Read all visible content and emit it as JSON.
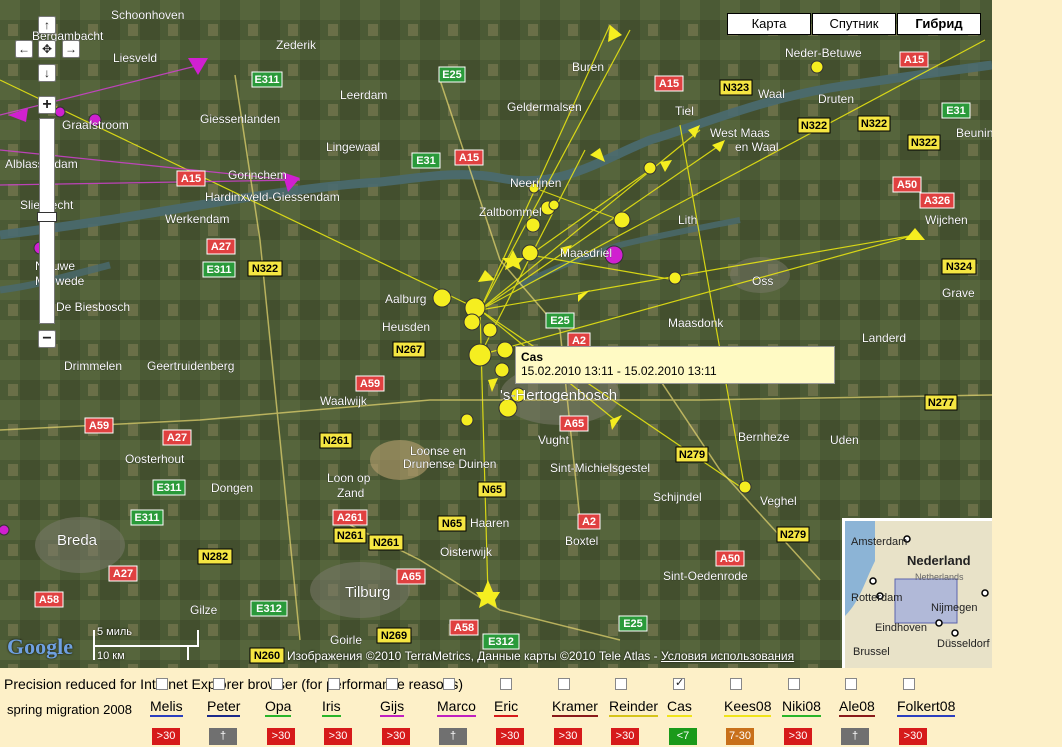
{
  "map": {
    "map_types": [
      "Карта",
      "Спутник",
      "Гибрид"
    ],
    "active_map_type": "Гибрид",
    "popup": {
      "title": "Cas",
      "time": "15.02.2010 13:11 - 15.02.2010 13:11"
    },
    "copyright": "Изображения ©2010 TerraMetrics, Данные карты ©2010 Tele Atlas - ",
    "terms_link": "Условия использования",
    "scale_miles": "5 миль",
    "scale_km": "10 км",
    "logo": "Google",
    "places": [
      "Schoonhoven",
      "Bergambacht",
      "Liesveld",
      "Zederik",
      "Buren",
      "Neder-Betuwe",
      "Leerdam",
      "Geldermalsen",
      "Tiel",
      "Waal",
      "Druten",
      "Giessenlanden",
      "Graafstroom",
      "Lingewaal",
      "West Maas en Waal",
      "Beunin",
      "Alblasserdam",
      "Gorinchem",
      "Neerijnen",
      "Hardinxveld-Giessendam",
      "Sliedrecht",
      "Zaltbommel",
      "Werkendam",
      "Lith",
      "Wijchen",
      "Maasdriel",
      "Oss",
      "Grave",
      "Nieuwe Merwede",
      "Aalburg",
      "De Biesbosch",
      "Heusden",
      "Maasdonk",
      "Landerd",
      "Drimmelen",
      "Geertruidenberg",
      "Waalwijk",
      "'s-Hertogenbosch",
      "Vught",
      "Bernheze",
      "Uden",
      "Loonse en Drunense Duinen",
      "Oosterhout",
      "Loon op Zand",
      "Sint-Michielsgestel",
      "Schijndel",
      "Veghel",
      "Dongen",
      "Haaren",
      "Boxtel",
      "Breda",
      "Oisterwijk",
      "Tilburg",
      "Sint-Oedenrode",
      "Gilze",
      "Goirle"
    ],
    "roads": [
      "E25",
      "E311",
      "A15",
      "N323",
      "E31",
      "N322",
      "A50",
      "A326",
      "A27",
      "N324",
      "A2",
      "N267",
      "A59",
      "A65",
      "N277",
      "N261",
      "A261",
      "N65",
      "N279",
      "E312",
      "N282",
      "N269",
      "A58",
      "N260"
    ],
    "overview_labels": [
      "Amsterdam",
      "Nederland",
      "Netherlands",
      "Rotterdam",
      "Nijmegen",
      "Eindhoven",
      "Düsseldorf",
      "Brussel"
    ]
  },
  "footer": {
    "precision_note": "Precision reduced for Internet Explorer browser (for performance reasons)",
    "series_label": "spring migration 2008"
  },
  "birds": [
    {
      "name": "Melis",
      "status": ">30",
      "checked": false,
      "status_color": "#d61a1a",
      "underline": "#2b3fbf"
    },
    {
      "name": "Peter",
      "status": "†",
      "checked": false,
      "status_color": "#707070",
      "underline": "#1a2a8a"
    },
    {
      "name": "Opa",
      "status": ">30",
      "checked": false,
      "status_color": "#d61a1a",
      "underline": "#2ab52a"
    },
    {
      "name": "Iris",
      "status": ">30",
      "checked": false,
      "status_color": "#d61a1a",
      "underline": "#2ab52a"
    },
    {
      "name": "Gijs",
      "status": ">30",
      "checked": false,
      "status_color": "#d61a1a",
      "underline": "#c020c0"
    },
    {
      "name": "Marco",
      "status": "†",
      "checked": false,
      "status_color": "#707070",
      "underline": "#c020c0"
    },
    {
      "name": "Eric",
      "status": ">30",
      "checked": false,
      "status_color": "#d61a1a",
      "underline": "#d61a1a"
    },
    {
      "name": "Kramer",
      "status": ">30",
      "checked": false,
      "status_color": "#d61a1a",
      "underline": "#8a1a1a"
    },
    {
      "name": "Reinder",
      "status": ">30",
      "checked": false,
      "status_color": "#d61a1a",
      "underline": "#d6c41a"
    },
    {
      "name": "Cas",
      "status": "<7",
      "checked": true,
      "status_color": "#1a9a1a",
      "underline": "#f0e41a"
    },
    {
      "name": "Kees08",
      "status": "7-30",
      "checked": false,
      "status_color": "#c8701a",
      "underline": "#f0e41a"
    },
    {
      "name": "Niki08",
      "status": ">30",
      "checked": false,
      "status_color": "#d61a1a",
      "underline": "#2ab52a"
    },
    {
      "name": "Ale08",
      "status": "†",
      "checked": false,
      "status_color": "#707070",
      "underline": "#8a1a1a"
    },
    {
      "name": "Folkert08",
      "status": ">30",
      "checked": false,
      "status_color": "#d61a1a",
      "underline": "#2b3fbf"
    }
  ]
}
